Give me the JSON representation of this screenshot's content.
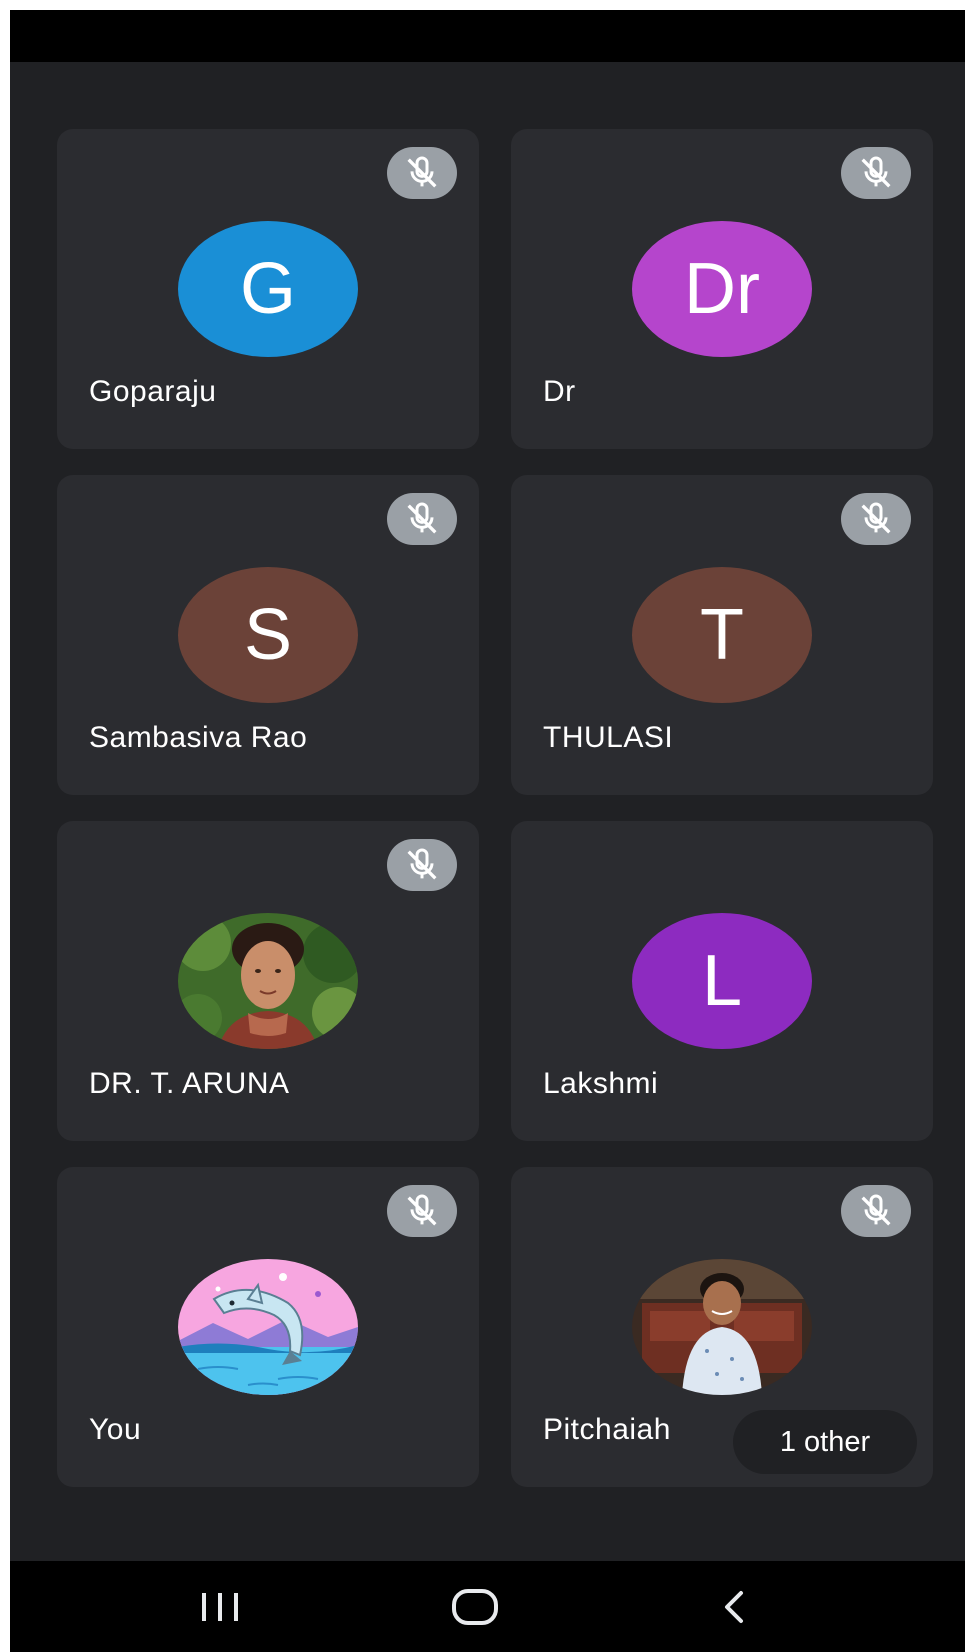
{
  "colors": {
    "background": "#202124",
    "tile": "#2b2c30",
    "mute_badge": "#9aa0a6",
    "status_bar": "#000000",
    "nav_bar": "#000000",
    "text": "#ffffff"
  },
  "participants": [
    {
      "name": "Goparaju",
      "initials": "G",
      "avatar_color": "#1a8fd6",
      "muted": true
    },
    {
      "name": "Dr",
      "initials": "Dr",
      "avatar_color": "#b545cc",
      "muted": true
    },
    {
      "name": "Sambasiva Rao",
      "initials": "S",
      "avatar_color": "#6b4238",
      "muted": true
    },
    {
      "name": "THULASI",
      "initials": "T",
      "avatar_color": "#6b4238",
      "muted": true
    },
    {
      "name": "DR. T. ARUNA",
      "avatar": "photo-woman",
      "muted": true
    },
    {
      "name": "Lakshmi",
      "initials": "L",
      "avatar_color": "#8d2bc0",
      "muted": false
    },
    {
      "name": "You",
      "avatar": "dolphin-illustration",
      "muted": true
    },
    {
      "name": "Pitchaiah",
      "avatar": "photo-child",
      "muted": true,
      "others_label": "1 other"
    }
  ],
  "nav": {
    "recents_icon": "recents-icon",
    "home_icon": "home-icon",
    "back_icon": "back-icon"
  }
}
